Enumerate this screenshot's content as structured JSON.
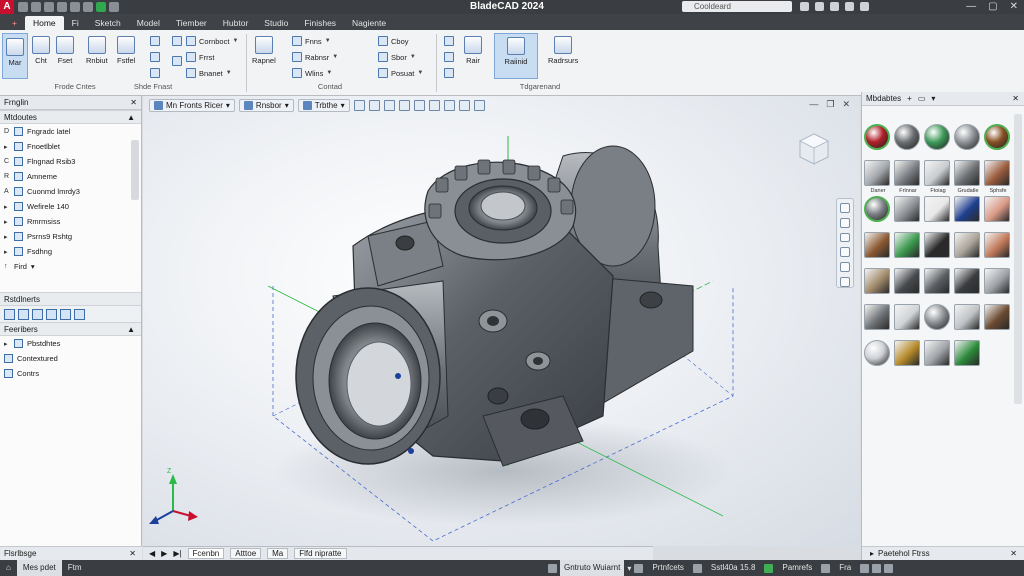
{
  "app": {
    "title": "BladeCAD 2024",
    "search_placeholder": "Cooldeard"
  },
  "ribbon_tabs": [
    "Home",
    "Fi",
    "Sketch",
    "Model",
    "Tiember",
    "Hubtor",
    "Studio",
    "Finishes",
    "Nagiente"
  ],
  "ribbon": {
    "buttons_left": [
      {
        "label": "Mar"
      },
      {
        "label": "Cht"
      },
      {
        "label": "Fset"
      },
      {
        "label": "Rnbiut"
      },
      {
        "label": "Fstfel"
      }
    ],
    "small_col1": [
      "Cornboct",
      "Frrst",
      "Bnanet"
    ],
    "small_col2": [
      "Fnns",
      "Rabnsr",
      "Wlins"
    ],
    "small_col3": [
      "Cboy",
      "Sbor",
      "Posuat"
    ],
    "big_mid": [
      "Rapnel",
      "Rair",
      "Raiinid",
      "Radrsurs"
    ],
    "groups": [
      "Frode Cntes",
      "Shde Fnast",
      "Contad",
      "Tdgarenand"
    ]
  },
  "left_panel": {
    "title": "Frnglin",
    "tree_header": "Mtdoutes",
    "tree": [
      {
        "prefix": "D",
        "label": "Fngradc latel"
      },
      {
        "prefix": "▸",
        "label": "Fnoetlblet"
      },
      {
        "prefix": "C",
        "label": "Flngnad Rsib3"
      },
      {
        "prefix": "R",
        "label": "Amneme"
      },
      {
        "prefix": "A",
        "label": "Cuonmd lmrdy3"
      },
      {
        "prefix": "▸",
        "label": "Wefirele 140"
      },
      {
        "prefix": "▸",
        "label": "Rmrmsiss"
      },
      {
        "prefix": "▸",
        "label": "Psrns9 Rshtg"
      },
      {
        "prefix": "▸",
        "label": "Fsdhng"
      },
      {
        "prefix": "↑",
        "label": "Fird"
      }
    ],
    "section1": "Rstdlnerts",
    "section2": "Feeribers",
    "section2_items": [
      "Pbstdhtes",
      "Contextured",
      "Contrs"
    ],
    "bottom": "Flsrlbsge"
  },
  "viewport": {
    "dropdown1": "Mn Fronts Ricer",
    "dropdown2": "Rnsbor",
    "dropdown3": "Trbthe",
    "axis_label": "Z"
  },
  "viewport_tabs": [
    "Fcenbn",
    "Atttoe",
    "Ma",
    "Flfd nipratte"
  ],
  "right_panel": {
    "title": "Mbdabtes",
    "bottom": "Paetehol Ftrss",
    "materials": [
      {
        "label": "",
        "color": "#b0202a",
        "round": true,
        "sel": true
      },
      {
        "label": "",
        "color": "#6b6e72",
        "round": true
      },
      {
        "label": "",
        "color": "#3f9a5a",
        "round": true
      },
      {
        "label": "",
        "color": "#8e9296",
        "round": true
      },
      {
        "label": "",
        "color": "#8a5226",
        "round": true,
        "sel": true
      },
      {
        "label": "Daner",
        "color": "#a4a8ad"
      },
      {
        "label": "Frlnnar",
        "color": "#7b7f84"
      },
      {
        "label": "Ftoiag",
        "color": "#c9ccd0"
      },
      {
        "label": "Grudatle",
        "color": "#6c6f73"
      },
      {
        "label": "Sphsfe",
        "color": "#9a5b3c"
      },
      {
        "label": "",
        "color": "#7f8388",
        "round": true,
        "sel": true
      },
      {
        "label": "",
        "color": "#8d9196"
      },
      {
        "label": "",
        "color": "#e8e8e8"
      },
      {
        "label": "",
        "color": "#1f3f8f"
      },
      {
        "label": "",
        "color": "#d99a86"
      },
      {
        "label": "",
        "color": "#8c5a33"
      },
      {
        "label": "",
        "color": "#3b9a4e"
      },
      {
        "label": "",
        "color": "#2a2a2a"
      },
      {
        "label": "",
        "color": "#a9a398"
      },
      {
        "label": "",
        "color": "#c27a5a"
      },
      {
        "label": "",
        "color": "#a08a6a"
      },
      {
        "label": "",
        "color": "#474a4e"
      },
      {
        "label": "",
        "color": "#5a5d61"
      },
      {
        "label": "",
        "color": "#3a3c3f"
      },
      {
        "label": "",
        "color": "#9da1a6"
      },
      {
        "label": "",
        "color": "#6e7276"
      },
      {
        "label": "",
        "color": "#d0d3d6"
      },
      {
        "label": "",
        "color": "#8f9397",
        "round": true
      },
      {
        "label": "",
        "color": "#bfc2c6"
      },
      {
        "label": "",
        "color": "#6a4a30"
      },
      {
        "label": "",
        "color": "#cfd2d6",
        "round": true
      },
      {
        "label": "",
        "color": "#b58a2a"
      },
      {
        "label": "",
        "color": "#a0a4a8"
      },
      {
        "label": "",
        "color": "#2c8a3a"
      }
    ]
  },
  "statusbar": {
    "left1": "Mes pdet",
    "left2": "Ftm",
    "mid1": "Gntruto Wuiarnt",
    "mid2": "Prtnfcets",
    "mid3": "Sstl40a 15.8",
    "mid4": "Pamrefs",
    "mid5": "Fra"
  }
}
